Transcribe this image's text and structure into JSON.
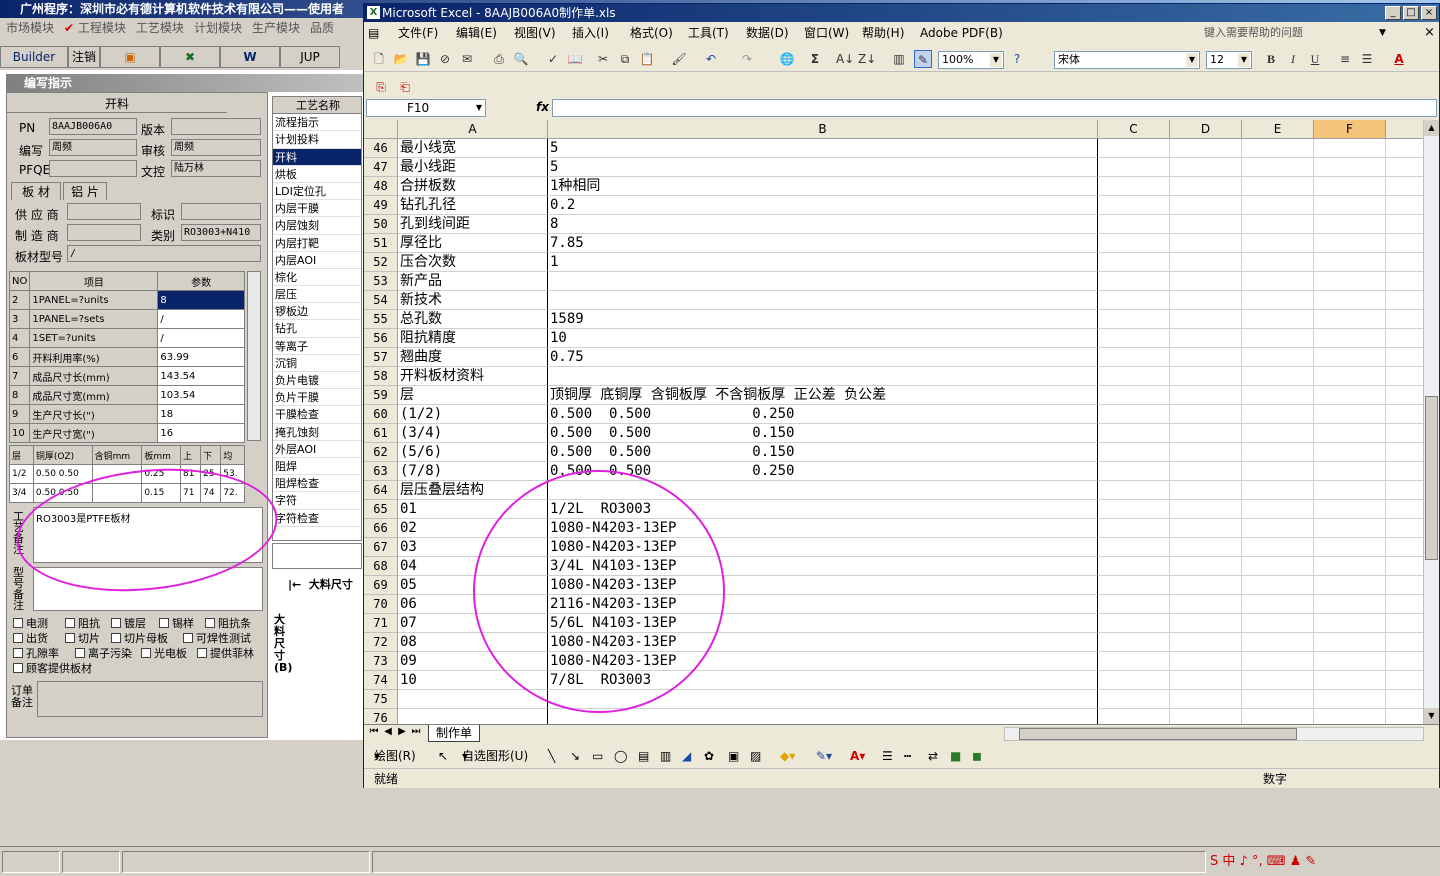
{
  "bg_app": {
    "title": "广州程序：深圳市必有德计算机软件技术有限公司——使用者",
    "menu": [
      "市场模块",
      "工程模块",
      "工艺模块",
      "计划模块",
      "生产模块",
      "品质"
    ],
    "toolbar": [
      "Builder",
      "注销",
      "",
      "",
      "W",
      "JUP"
    ],
    "panel_title": "编写指示",
    "form": {
      "section": "开料",
      "pn_label": "PN",
      "pn_value": "8AAJB006A0",
      "version_label": "版本",
      "version_value": "",
      "author_label": "编写",
      "author_value": "周频",
      "review_label": "审核",
      "review_value": "周频",
      "pfqe_label": "PFQE",
      "pfqe_value": "",
      "doc_label": "文控",
      "doc_value": "陆万林",
      "tab1": "板 材",
      "tab2": "铝 片",
      "supplier_label": "供 应 商",
      "mark_label": "标识",
      "maker_label": "制 造 商",
      "category_label": "类别",
      "category_value": "RO3003+N410",
      "board_type_label": "板材型号",
      "board_type_value": "/",
      "grid_headers": [
        "NO",
        "项目",
        "参数"
      ],
      "grid_rows": [
        [
          "2",
          "1PANEL=?units",
          "8"
        ],
        [
          "3",
          "1PANEL=?sets",
          "/"
        ],
        [
          "4",
          "1SET=?units",
          "/"
        ],
        [
          "6",
          "开料利用率(%)",
          "63.99"
        ],
        [
          "7",
          "成品尺寸长(mm)",
          "143.54"
        ],
        [
          "8",
          "成品尺寸宽(mm)",
          "103.54"
        ],
        [
          "9",
          "生产尺寸长(\")",
          "18"
        ],
        [
          "10",
          "生产尺寸宽(\")",
          "16"
        ]
      ],
      "layer_headers": [
        "层",
        "铜厚(OZ)",
        "含铜mm",
        "板mm",
        "上",
        "下",
        "均"
      ],
      "layer_rows": [
        [
          "1/2",
          "0.50 0.50",
          "",
          "0.25",
          "81",
          "25",
          "53."
        ],
        [
          "3/4",
          "0.50 0.50",
          "",
          "0.15",
          "71",
          "74",
          "72."
        ]
      ],
      "process_note_label": "工艺备注",
      "process_note_value": "RO3003是PTFE板材",
      "model_note_label": "型号备注",
      "checkboxes": [
        "电测",
        "阻抗",
        "镀层",
        "锡样",
        "阻抗条",
        "出货",
        "切片",
        "切片母板",
        "可焊性测试",
        "孔隙率",
        "离子污染",
        "光电板",
        "提供菲林",
        "顾客提供板材"
      ],
      "order_note_label": "订单备注"
    },
    "tech_list_header": "工艺名称",
    "tech_list": [
      "流程指示",
      "计划投料",
      "开料",
      "烘板",
      "LDI定位孔",
      "内层干膜",
      "内层蚀刻",
      "内层打靶",
      "内层AOI",
      "棕化",
      "层压",
      "锣板边",
      "钻孔",
      "等离子",
      "沉铜",
      "负片电镀",
      "负片干膜",
      "干膜检查",
      "掩孔蚀刻",
      "外层AOI",
      "阻焊",
      "阻焊检查",
      "字符",
      "字符检查"
    ],
    "tech_list_selected": "开料",
    "dim_label_h": "大料尺寸",
    "dim_label_v": "大料尺寸(B)"
  },
  "excel": {
    "title": "Microsoft Excel - 8AAJB006A0制作单.xls",
    "menu": [
      "文件(F)",
      "编辑(E)",
      "视图(V)",
      "插入(I)",
      "格式(O)",
      "工具(T)",
      "数据(D)",
      "窗口(W)",
      "帮助(H)",
      "Adobe PDF(B)"
    ],
    "help_placeholder": "键入需要帮助的问题",
    "zoom": "100%",
    "font": "宋体",
    "font_size": "12",
    "name_box": "F10",
    "fx": "fx",
    "columns": [
      "A",
      "B",
      "C",
      "D",
      "E",
      "F"
    ],
    "active_column": "F",
    "rows": [
      {
        "n": "46",
        "a": "最小线宽",
        "b": "5"
      },
      {
        "n": "47",
        "a": "最小线距",
        "b": "5"
      },
      {
        "n": "48",
        "a": "合拼板数",
        "b": "1种相同"
      },
      {
        "n": "49",
        "a": "钻孔孔径",
        "b": "0.2"
      },
      {
        "n": "50",
        "a": "孔到线间距",
        "b": "8"
      },
      {
        "n": "51",
        "a": "厚径比",
        "b": "7.85"
      },
      {
        "n": "52",
        "a": "压合次数",
        "b": "1"
      },
      {
        "n": "53",
        "a": "新产品",
        "b": ""
      },
      {
        "n": "54",
        "a": "新技术",
        "b": ""
      },
      {
        "n": "55",
        "a": "总孔数",
        "b": "1589"
      },
      {
        "n": "56",
        "a": "阻抗精度",
        "b": "10"
      },
      {
        "n": "57",
        "a": "翘曲度",
        "b": "0.75"
      },
      {
        "n": "58",
        "a": "开料板材资料",
        "b": ""
      },
      {
        "n": "59",
        "a": "层",
        "b": "顶铜厚 底铜厚 含铜板厚 不含铜板厚 正公差 负公差"
      },
      {
        "n": "60",
        "a": "(1/2)",
        "b": "0.500  0.500            0.250"
      },
      {
        "n": "61",
        "a": "(3/4)",
        "b": "0.500  0.500            0.150"
      },
      {
        "n": "62",
        "a": "(5/6)",
        "b": "0.500  0.500            0.150"
      },
      {
        "n": "63",
        "a": "(7/8)",
        "b": "0.500  0.500            0.250"
      },
      {
        "n": "64",
        "a": "层压叠层结构",
        "b": ""
      },
      {
        "n": "65",
        "a": "01",
        "b": "1/2L  RO3003"
      },
      {
        "n": "66",
        "a": "02",
        "b": "1080-N4203-13EP"
      },
      {
        "n": "67",
        "a": "03",
        "b": "1080-N4203-13EP"
      },
      {
        "n": "68",
        "a": "04",
        "b": "3/4L N4103-13EP"
      },
      {
        "n": "69",
        "a": "05",
        "b": "1080-N4203-13EP"
      },
      {
        "n": "70",
        "a": "06",
        "b": "2116-N4203-13EP"
      },
      {
        "n": "71",
        "a": "07",
        "b": "5/6L N4103-13EP"
      },
      {
        "n": "72",
        "a": "08",
        "b": "1080-N4203-13EP"
      },
      {
        "n": "73",
        "a": "09",
        "b": "1080-N4203-13EP"
      },
      {
        "n": "74",
        "a": "10",
        "b": "7/8L  RO3003"
      },
      {
        "n": "75",
        "a": "",
        "b": ""
      },
      {
        "n": "76",
        "a": "",
        "b": ""
      }
    ],
    "sheet_tab": "制作单",
    "draw_label": "绘图(R)",
    "autoshape_label": "自选图形(U)",
    "status_left": "就绪",
    "status_right": "数字"
  },
  "taskbar": {
    "ime": "S 中 ♪ °, ⌨ ♟ ✎"
  },
  "colors": {
    "highlight": "#e020e0",
    "title_bar": "#0a246a",
    "selection": "#0a246a"
  }
}
